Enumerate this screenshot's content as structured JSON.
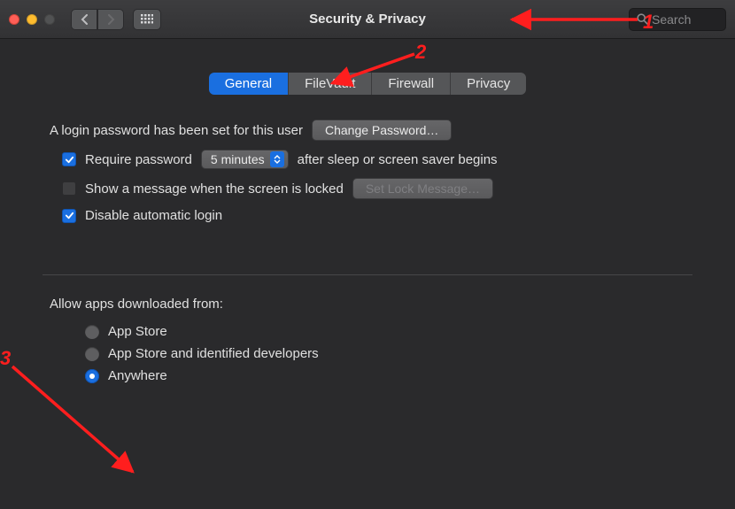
{
  "titlebar": {
    "title": "Security & Privacy",
    "search_placeholder": "Search"
  },
  "tabs": [
    {
      "label": "General",
      "active": true
    },
    {
      "label": "FileVault",
      "active": false
    },
    {
      "label": "Firewall",
      "active": false
    },
    {
      "label": "Privacy",
      "active": false
    }
  ],
  "login_password": {
    "text": "A login password has been set for this user",
    "change_button": "Change Password…"
  },
  "require_password": {
    "checked": true,
    "label_before": "Require password",
    "delay_value": "5 minutes",
    "label_after": "after sleep or screen saver begins"
  },
  "show_message": {
    "checked": false,
    "label": "Show a message when the screen is locked",
    "button": "Set Lock Message…"
  },
  "disable_auto_login": {
    "checked": true,
    "label": "Disable automatic login"
  },
  "allow_apps": {
    "title": "Allow apps downloaded from:",
    "options": [
      {
        "label": "App Store",
        "selected": false
      },
      {
        "label": "App Store and identified developers",
        "selected": false
      },
      {
        "label": "Anywhere",
        "selected": true
      }
    ]
  },
  "annotations": {
    "n1": "1",
    "n2": "2",
    "n3": "3"
  }
}
